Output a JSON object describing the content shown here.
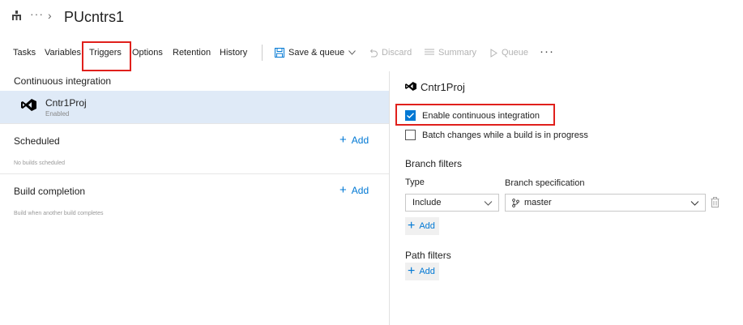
{
  "breadcrumb": {
    "ellipsis": "···",
    "separator": "›",
    "title": "PUcntrs1"
  },
  "tabs": [
    {
      "label": "Tasks"
    },
    {
      "label": "Variables"
    },
    {
      "label": "Triggers"
    },
    {
      "label": "Options"
    },
    {
      "label": "Retention"
    },
    {
      "label": "History"
    }
  ],
  "toolbar": {
    "save_queue": "Save & queue",
    "discard": "Discard",
    "summary": "Summary",
    "queue": "Queue",
    "more": "···"
  },
  "left": {
    "ci": {
      "title": "Continuous integration",
      "item_name": "Cntr1Proj",
      "item_status": "Enabled"
    },
    "scheduled": {
      "title": "Scheduled",
      "add": "Add",
      "empty": "No builds scheduled"
    },
    "build_completion": {
      "title": "Build completion",
      "add": "Add",
      "empty": "Build when another build completes"
    }
  },
  "right": {
    "title": "Cntr1Proj",
    "enable_ci": {
      "label": "Enable continuous integration",
      "checked": true
    },
    "batch": {
      "label": "Batch changes while a build is in progress",
      "checked": false
    },
    "branch_filters": {
      "title": "Branch filters",
      "type_label": "Type",
      "spec_label": "Branch specification",
      "type_value": "Include",
      "spec_value": "master",
      "add": "Add"
    },
    "path_filters": {
      "title": "Path filters",
      "add": "Add"
    }
  },
  "colors": {
    "accent": "#0078d4",
    "highlight_box": "#e0201c",
    "selected_row": "#dfeaf7",
    "vs_purple": "#000000"
  }
}
